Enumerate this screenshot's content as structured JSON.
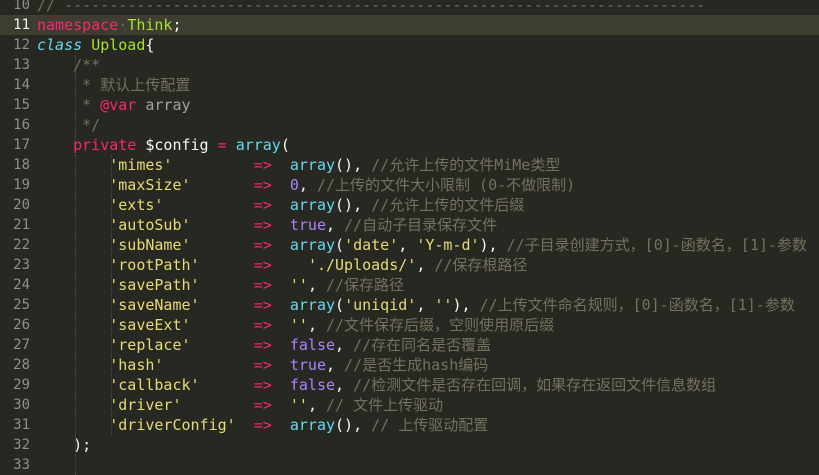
{
  "editor": {
    "lines": [
      {
        "no": "10",
        "segments": [
          [
            "c",
            "// -----------------------------------------------------------------------"
          ]
        ]
      },
      {
        "no": "11",
        "current": true,
        "segments": [
          [
            "k",
            "namespace"
          ],
          [
            "c",
            "·"
          ],
          [
            "t",
            "Think"
          ],
          [
            "w",
            ";"
          ]
        ]
      },
      {
        "no": "12",
        "segments": [
          [
            "ki",
            "class"
          ],
          [
            "w",
            " "
          ],
          [
            "t",
            "Upload"
          ],
          [
            "w",
            "{"
          ]
        ]
      },
      {
        "no": "13",
        "segments": [
          [
            "w",
            "    "
          ],
          [
            "c",
            "/**"
          ]
        ]
      },
      {
        "no": "14",
        "segments": [
          [
            "w",
            "    "
          ],
          [
            "c",
            " * 默认上传配置"
          ]
        ]
      },
      {
        "no": "15",
        "segments": [
          [
            "w",
            "    "
          ],
          [
            "c",
            " * "
          ],
          [
            "tag",
            "@var"
          ],
          [
            "dim",
            " array"
          ]
        ]
      },
      {
        "no": "16",
        "segments": [
          [
            "w",
            "    "
          ],
          [
            "c",
            " */"
          ]
        ]
      },
      {
        "no": "17",
        "segments": [
          [
            "w",
            "    "
          ],
          [
            "k",
            "private"
          ],
          [
            "w",
            " $config "
          ],
          [
            "k",
            "="
          ],
          [
            "w",
            " "
          ],
          [
            "f",
            "array"
          ],
          [
            "w",
            "("
          ]
        ]
      },
      {
        "no": "18",
        "segments": [
          [
            "w",
            "        "
          ],
          [
            "s",
            "'mimes'"
          ],
          [
            "w",
            "         "
          ],
          [
            "a",
            "=>"
          ],
          [
            "w",
            "  "
          ],
          [
            "f",
            "array"
          ],
          [
            "w",
            "(), "
          ],
          [
            "c",
            "//允许上传的文件MiMe类型"
          ]
        ]
      },
      {
        "no": "19",
        "segments": [
          [
            "w",
            "        "
          ],
          [
            "s",
            "'maxSize'"
          ],
          [
            "w",
            "       "
          ],
          [
            "a",
            "=>"
          ],
          [
            "w",
            "  "
          ],
          [
            "n",
            "0"
          ],
          [
            "w",
            ", "
          ],
          [
            "c",
            "//上传的文件大小限制 (0-不做限制)"
          ]
        ]
      },
      {
        "no": "20",
        "segments": [
          [
            "w",
            "        "
          ],
          [
            "s",
            "'exts'"
          ],
          [
            "w",
            "          "
          ],
          [
            "a",
            "=>"
          ],
          [
            "w",
            "  "
          ],
          [
            "f",
            "array"
          ],
          [
            "w",
            "(), "
          ],
          [
            "c",
            "//允许上传的文件后缀"
          ]
        ]
      },
      {
        "no": "21",
        "segments": [
          [
            "w",
            "        "
          ],
          [
            "s",
            "'autoSub'"
          ],
          [
            "w",
            "       "
          ],
          [
            "a",
            "=>"
          ],
          [
            "w",
            "  "
          ],
          [
            "n",
            "true"
          ],
          [
            "w",
            ", "
          ],
          [
            "c",
            "//自动子目录保存文件"
          ]
        ]
      },
      {
        "no": "22",
        "segments": [
          [
            "w",
            "        "
          ],
          [
            "s",
            "'subName'"
          ],
          [
            "w",
            "       "
          ],
          [
            "a",
            "=>"
          ],
          [
            "w",
            "  "
          ],
          [
            "f",
            "array"
          ],
          [
            "w",
            "("
          ],
          [
            "s",
            "'date'"
          ],
          [
            "w",
            ", "
          ],
          [
            "s",
            "'Y-m-d'"
          ],
          [
            "w",
            "), "
          ],
          [
            "c",
            "//子目录创建方式，[0]-函数名，[1]-参数"
          ]
        ]
      },
      {
        "no": "23",
        "segments": [
          [
            "w",
            "        "
          ],
          [
            "s",
            "'rootPath'"
          ],
          [
            "w",
            "      "
          ],
          [
            "a",
            "=>"
          ],
          [
            "w",
            "    "
          ],
          [
            "s",
            "'./Uploads/'"
          ],
          [
            "w",
            ", "
          ],
          [
            "c",
            "//保存根路径"
          ]
        ]
      },
      {
        "no": "24",
        "segments": [
          [
            "w",
            "        "
          ],
          [
            "s",
            "'savePath'"
          ],
          [
            "w",
            "      "
          ],
          [
            "a",
            "=>"
          ],
          [
            "w",
            "  "
          ],
          [
            "s",
            "''"
          ],
          [
            "w",
            ", "
          ],
          [
            "c",
            "//保存路径"
          ]
        ]
      },
      {
        "no": "25",
        "segments": [
          [
            "w",
            "        "
          ],
          [
            "s",
            "'saveName'"
          ],
          [
            "w",
            "      "
          ],
          [
            "a",
            "=>"
          ],
          [
            "w",
            "  "
          ],
          [
            "f",
            "array"
          ],
          [
            "w",
            "("
          ],
          [
            "s",
            "'uniqid'"
          ],
          [
            "w",
            ", "
          ],
          [
            "s",
            "''"
          ],
          [
            "w",
            "), "
          ],
          [
            "c",
            "//上传文件命名规则，[0]-函数名，[1]-参数"
          ]
        ]
      },
      {
        "no": "26",
        "segments": [
          [
            "w",
            "        "
          ],
          [
            "s",
            "'saveExt'"
          ],
          [
            "w",
            "       "
          ],
          [
            "a",
            "=>"
          ],
          [
            "w",
            "  "
          ],
          [
            "s",
            "''"
          ],
          [
            "w",
            ", "
          ],
          [
            "c",
            "//文件保存后缀，空则使用原后缀"
          ]
        ]
      },
      {
        "no": "27",
        "segments": [
          [
            "w",
            "        "
          ],
          [
            "s",
            "'replace'"
          ],
          [
            "w",
            "       "
          ],
          [
            "a",
            "=>"
          ],
          [
            "w",
            "  "
          ],
          [
            "n",
            "false"
          ],
          [
            "w",
            ", "
          ],
          [
            "c",
            "//存在同名是否覆盖"
          ]
        ]
      },
      {
        "no": "28",
        "segments": [
          [
            "w",
            "        "
          ],
          [
            "s",
            "'hash'"
          ],
          [
            "w",
            "          "
          ],
          [
            "a",
            "=>"
          ],
          [
            "w",
            "  "
          ],
          [
            "n",
            "true"
          ],
          [
            "w",
            ", "
          ],
          [
            "c",
            "//是否生成hash编码"
          ]
        ]
      },
      {
        "no": "29",
        "segments": [
          [
            "w",
            "        "
          ],
          [
            "s",
            "'callback'"
          ],
          [
            "w",
            "      "
          ],
          [
            "a",
            "=>"
          ],
          [
            "w",
            "  "
          ],
          [
            "n",
            "false"
          ],
          [
            "w",
            ", "
          ],
          [
            "c",
            "//检测文件是否存在回调，如果存在返回文件信息数组"
          ]
        ]
      },
      {
        "no": "30",
        "segments": [
          [
            "w",
            "        "
          ],
          [
            "s",
            "'driver'"
          ],
          [
            "w",
            "        "
          ],
          [
            "a",
            "=>"
          ],
          [
            "w",
            "  "
          ],
          [
            "s",
            "''"
          ],
          [
            "w",
            ", "
          ],
          [
            "c",
            "// 文件上传驱动"
          ]
        ]
      },
      {
        "no": "31",
        "segments": [
          [
            "w",
            "        "
          ],
          [
            "s",
            "'driverConfig'"
          ],
          [
            "w",
            "  "
          ],
          [
            "a",
            "=>"
          ],
          [
            "w",
            "  "
          ],
          [
            "f",
            "array"
          ],
          [
            "w",
            "(), "
          ],
          [
            "c",
            "// 上传驱动配置"
          ]
        ]
      },
      {
        "no": "32",
        "segments": [
          [
            "w",
            "    );"
          ]
        ]
      },
      {
        "no": "33",
        "segments": []
      }
    ]
  }
}
